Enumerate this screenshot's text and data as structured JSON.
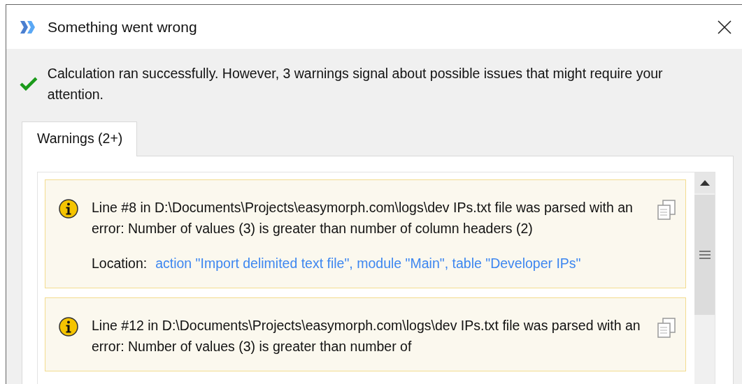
{
  "window": {
    "title": "Something went wrong"
  },
  "message": "Calculation ran successfully. However, 3 warnings signal about possible issues that might require your attention.",
  "tabs": [
    {
      "label": "Warnings (2+)",
      "selected": true
    }
  ],
  "warnings": [
    {
      "text": "Line #8 in D:\\Documents\\Projects\\easymorph.com\\logs\\dev IPs.txt file was parsed with an error: Number of values (3) is greater than number of column headers (2)",
      "location_label": "Location:",
      "location": "action \"Import delimited text file\", module \"Main\", table \"Developer IPs\""
    },
    {
      "text": "Line #12 in D:\\Documents\\Projects\\easymorph.com\\logs\\dev IPs.txt file was parsed with an error: Number of values (3) is greater than number of"
    }
  ]
}
